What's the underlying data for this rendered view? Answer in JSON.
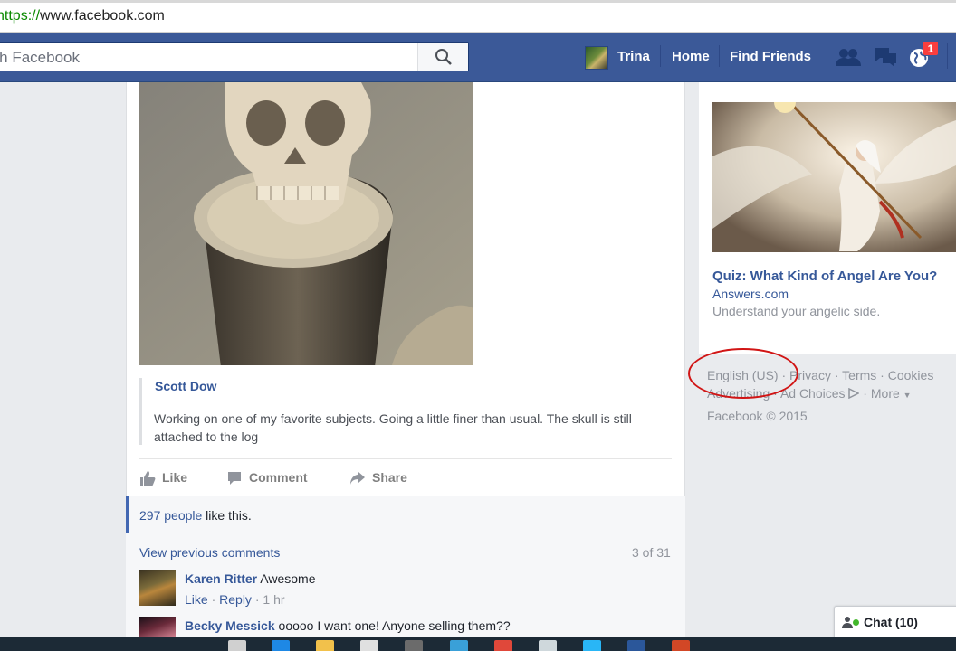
{
  "browser": {
    "url_protocol": "https://",
    "url_rest": "www.facebook.com"
  },
  "header": {
    "search_placeholder": "rch Facebook",
    "user_name": "Trina",
    "nav": {
      "home": "Home",
      "find_friends": "Find Friends"
    },
    "notification_count": "1",
    "colors": {
      "bar": "#3b5998",
      "badge": "#fa3e3e"
    }
  },
  "post": {
    "quote_author": "Scott Dow",
    "quote_text": "Working on one of my favorite subjects. Going a little finer than usual. The skull is still attached to the log",
    "actions": {
      "like": "Like",
      "comment": "Comment",
      "share": "Share"
    },
    "likes_link": "297 people",
    "likes_suffix": " like this."
  },
  "comments": {
    "view_previous": "View previous comments",
    "count": "3 of 31",
    "items": [
      {
        "name": "Karen Ritter",
        "text": " Awesome",
        "like": "Like",
        "reply": "Reply",
        "time": "1 hr"
      },
      {
        "name": "Becky Messick",
        "text": " ooooo I want one! Anyone selling them??"
      }
    ]
  },
  "sidebar": {
    "ad": {
      "title": "Quiz: What Kind of Angel Are You?",
      "source": "Answers.com",
      "description": "Understand your angelic side."
    },
    "footer": {
      "language": "English (US)",
      "privacy": "Privacy",
      "terms": "Terms",
      "cookies": "Cookies",
      "advertising": "Advertising",
      "ad_choices": "Ad Choices",
      "more": "More",
      "copyright": "Facebook © 2015"
    }
  },
  "chat": {
    "label": "Chat (10)"
  }
}
